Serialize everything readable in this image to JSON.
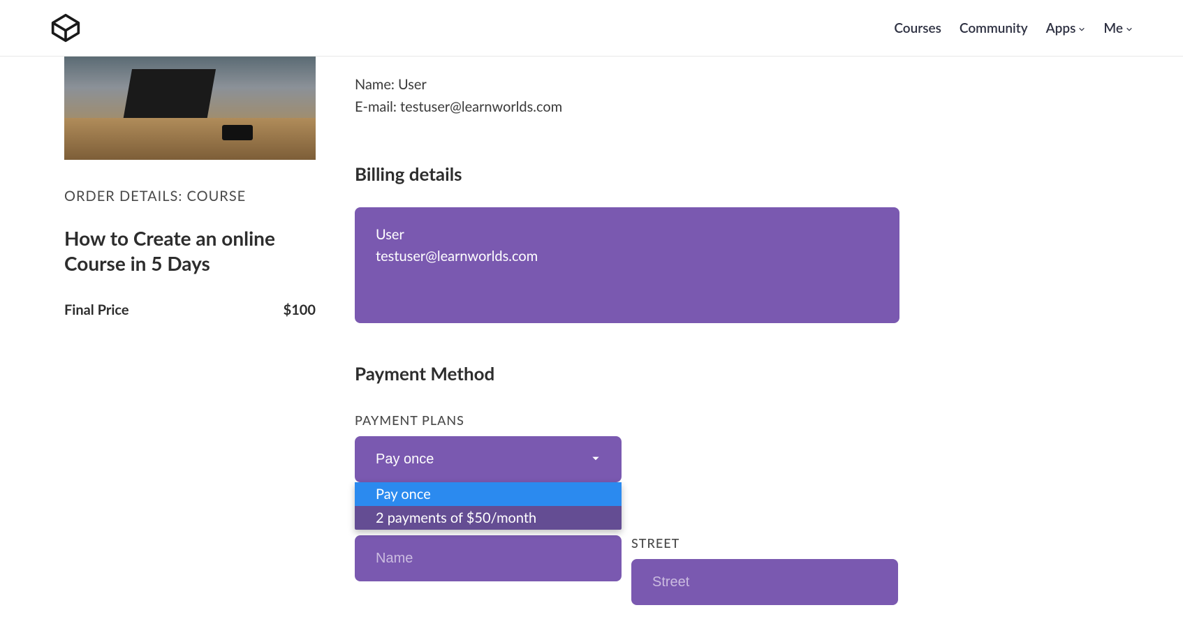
{
  "nav": {
    "courses": "Courses",
    "community": "Community",
    "apps": "Apps",
    "me": "Me"
  },
  "order": {
    "details_label": "ORDER DETAILS: COURSE",
    "course_title": "How to Create an online Course in 5 Days",
    "final_price_label": "Final Price",
    "final_price_value": "$100"
  },
  "account": {
    "name_label": "Name:",
    "name_value": "User",
    "email_label": "E-mail:",
    "email_value": "testuser@learnworlds.com"
  },
  "billing": {
    "heading": "Billing details",
    "card_name": "User",
    "card_email": "testuser@learnworlds.com"
  },
  "payment": {
    "heading": "Payment Method",
    "plans_label": "PAYMENT PLANS",
    "selected": "Pay once",
    "options": {
      "opt0": "Pay once",
      "opt1": "2 payments of $50/month"
    }
  },
  "fields": {
    "street_label": "STREET",
    "name_placeholder": "Name",
    "street_placeholder": "Street"
  },
  "colors": {
    "accent": "#7a59b0",
    "highlight": "#2b8aef"
  }
}
